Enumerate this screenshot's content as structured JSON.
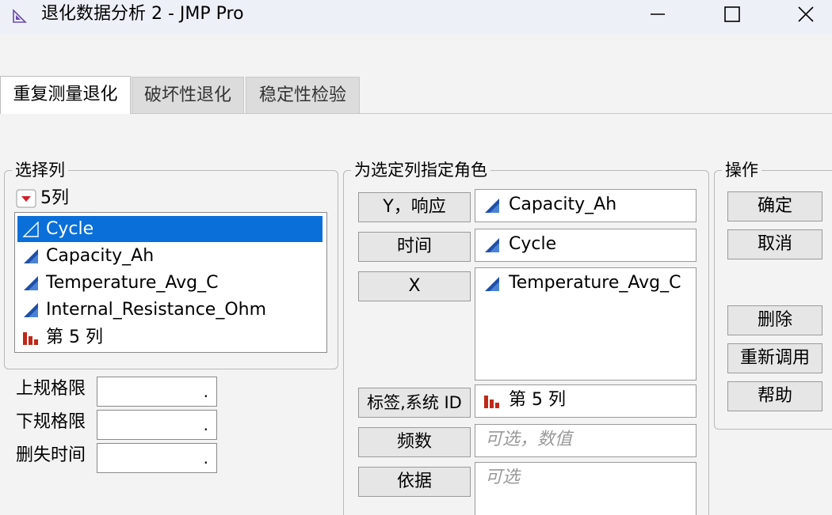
{
  "window": {
    "title": "退化数据分析 2 - JMP Pro"
  },
  "tabs": [
    {
      "label": "重复测量退化",
      "active": true
    },
    {
      "label": "破坏性退化",
      "active": false
    },
    {
      "label": "稳定性检验",
      "active": false
    }
  ],
  "select_columns": {
    "title": "选择列",
    "count_label": "5列",
    "items": [
      {
        "label": "Cycle",
        "icon": "continuous-icon",
        "selected": true
      },
      {
        "label": "Capacity_Ah",
        "icon": "continuous-icon",
        "selected": false
      },
      {
        "label": "Temperature_Avg_C",
        "icon": "continuous-icon",
        "selected": false
      },
      {
        "label": "Internal_Resistance_Ohm",
        "icon": "continuous-icon",
        "selected": false
      },
      {
        "label": "第 5 列",
        "icon": "nominal-bar-icon",
        "selected": false
      }
    ]
  },
  "spec_limits": {
    "usl_label": "上规格限",
    "usl_value": ".",
    "lsl_label": "下规格限",
    "lsl_value": ".",
    "censor_label": "删失时间",
    "censor_value": "."
  },
  "roles": {
    "title": "为选定列指定角色",
    "y": {
      "button": "Y，响应",
      "value": "Capacity_Ah"
    },
    "time": {
      "button": "时间",
      "value": "Cycle"
    },
    "x": {
      "button": "X",
      "value": "Temperature_Avg_C"
    },
    "label": {
      "button": "标签,系统 ID",
      "value": "第 5 列"
    },
    "freq": {
      "button": "频数",
      "placeholder": "可选，数值"
    },
    "by": {
      "button": "依据",
      "placeholder": "可选"
    }
  },
  "actions": {
    "title": "操作",
    "ok": "确定",
    "cancel": "取消",
    "remove": "删除",
    "recall": "重新调用",
    "help": "帮助"
  },
  "colors": {
    "selection": "#0a6fd8",
    "continuous_icon": "#1f4fa8",
    "nominal_icon": "#c0281a",
    "dropdown_icon": "#d0202a"
  }
}
